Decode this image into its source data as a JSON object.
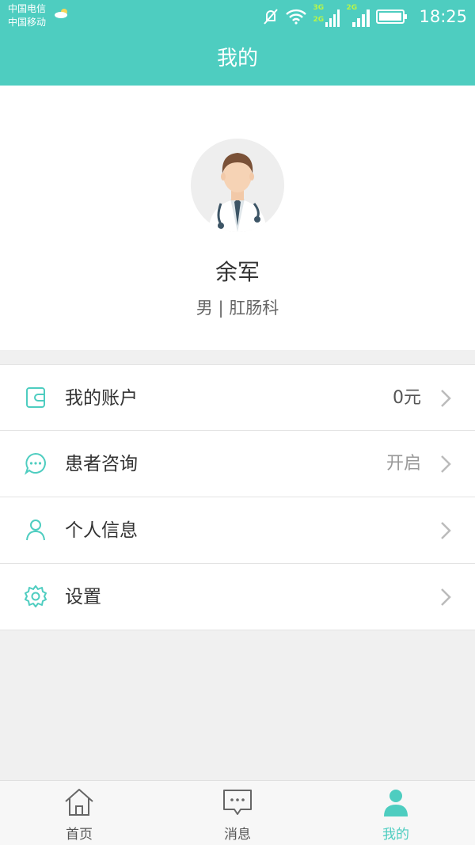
{
  "status_bar": {
    "carrier1": "中国电信",
    "carrier2": "中国移动",
    "network1": "3G",
    "network2": "2G",
    "network3": "2G",
    "time": "18:25"
  },
  "header": {
    "title": "我的"
  },
  "profile": {
    "name": "余军",
    "subtitle": "男 | 肛肠科"
  },
  "menu": [
    {
      "label": "我的账户",
      "value": "0元",
      "icon": "wallet-icon"
    },
    {
      "label": "患者咨询",
      "value": "开启",
      "icon": "chat-bubble-icon"
    },
    {
      "label": "个人信息",
      "value": "",
      "icon": "person-icon"
    },
    {
      "label": "设置",
      "value": "",
      "icon": "gear-icon"
    }
  ],
  "tabs": [
    {
      "label": "首页",
      "icon": "home-icon",
      "active": false
    },
    {
      "label": "消息",
      "icon": "message-icon",
      "active": false
    },
    {
      "label": "我的",
      "icon": "user-icon",
      "active": true
    }
  ],
  "colors": {
    "accent": "#4ecdc0",
    "text": "#333333",
    "muted": "#999999",
    "background": "#f0f0f0"
  }
}
